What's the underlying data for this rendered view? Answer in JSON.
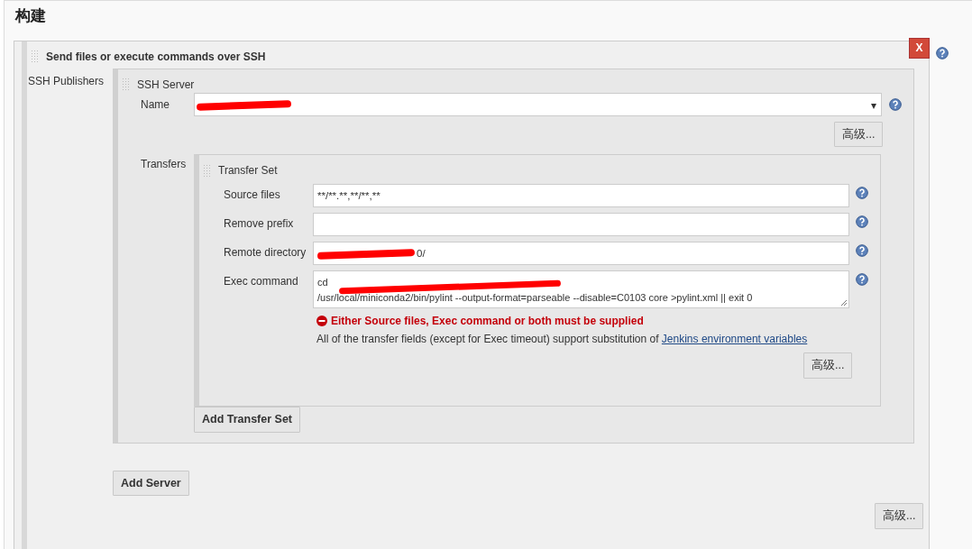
{
  "section_title": "构建",
  "step": {
    "title": "Send files or execute commands over SSH",
    "remove_button": "X",
    "publishers_label": "SSH Publishers",
    "server": {
      "title": "SSH Server",
      "name_label": "Name",
      "name_redacted": true,
      "caret": "▾",
      "advanced_button": "高级...",
      "transfers_label": "Transfers",
      "transfer_set": {
        "title": "Transfer Set",
        "fields": [
          {
            "kind": "input",
            "label": "Source files",
            "value": "**/**.**,**/**,**",
            "redacted": false
          },
          {
            "kind": "input",
            "label": "Remove prefix",
            "redacted": false
          },
          {
            "kind": "input",
            "label": "Remote directory",
            "value": "0/",
            "redacted": true
          },
          {
            "kind": "textarea",
            "label": "Exec command",
            "lines": [
              "cd",
              "/usr/local/miniconda2/bin/pylint --output-format=parseable  --disable=C0103 core  >pylint.xml  || exit 0"
            ],
            "redacted": true
          }
        ],
        "error": "Either Source files, Exec command or both must be supplied",
        "hint": "All of the transfer fields (except for Exec timeout) support substitution of",
        "hint_link": "Jenkins environment variables",
        "advanced_button": "高级..."
      },
      "add_transfer_button": "Add Transfer Set"
    },
    "add_server_button": "Add Server"
  },
  "advanced_button": "高级..."
}
